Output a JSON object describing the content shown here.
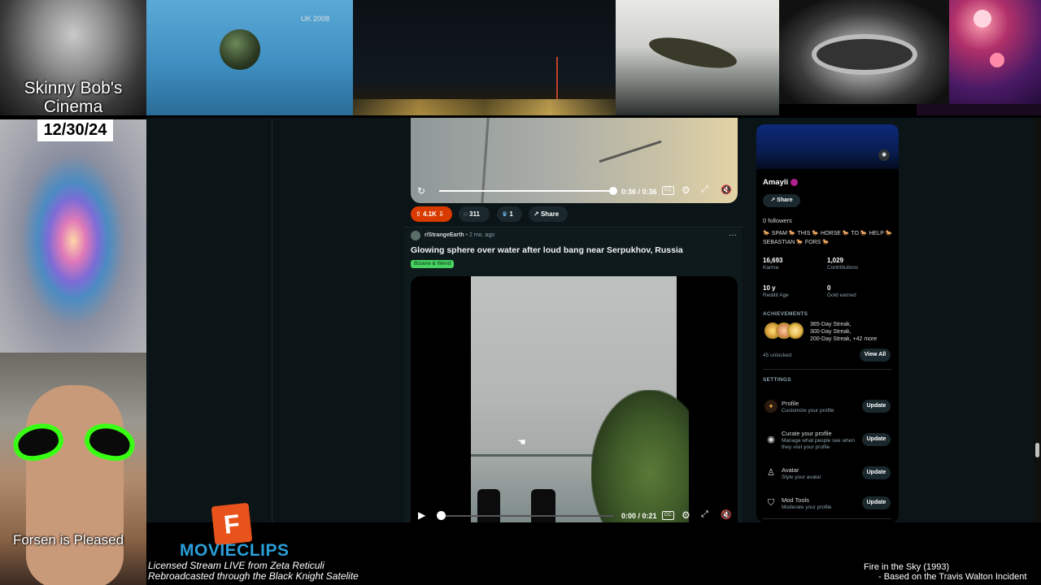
{
  "overlay": {
    "cinema_title": "Skinny Bob's Cinema",
    "date": "12/30/24",
    "thumb2_text": "UK 2008",
    "forsen_caption": "Forsen is Pleased",
    "movieclips_brand": "MOVIECLIPS",
    "licensed_line1": "Licensed Stream LIVE from Zeta Reticuli",
    "licensed_line2": "Rebroadcasted through the Black Knight Satelite",
    "movie_title": "Fire in the Sky (1993)",
    "movie_subtitle": "- Based on the Travis Walton Incident"
  },
  "post1": {
    "time": "0:36 / 0:36",
    "progress": 1.0,
    "vote_count": "4.1K",
    "comment_count": "311",
    "award_count": "1",
    "share_label": "Share"
  },
  "post2": {
    "subreddit": "r/StrangeEarth",
    "age": "2 mo. ago",
    "title": "Glowing sphere over water after loud bang near Serpukhov, Russia",
    "flair": "Bizarre & Weird",
    "time": "0:00 / 0:21",
    "progress": 0.0
  },
  "profile": {
    "username": "Amayli",
    "share_label": "Share",
    "followers": "0 followers",
    "bio": "🐎 SPAM 🐎 THIS 🐎 HORSE 🐎 TO 🐎 HELP 🐎 SEBASTIAN 🐎 FORS 🐎",
    "karma_value": "16,693",
    "karma_label": "Karma",
    "contrib_value": "1,029",
    "contrib_label": "Contributions",
    "age_value": "10 y",
    "age_label": "Reddit Age",
    "gold_value": "0",
    "gold_label": "Gold earned",
    "achievements_heading": "ACHIEVEMENTS",
    "achievements_line1": "365-Day Streak,",
    "achievements_line2": "300-Day Streak,",
    "achievements_line3": "200-Day Streak, +42 more",
    "unlocked": "45 unlocked",
    "view_all": "View All",
    "settings_heading": "SETTINGS",
    "settings": [
      {
        "title": "Profile",
        "desc": "Customize your profile",
        "button": "Update"
      },
      {
        "title": "Curate your profile",
        "desc": "Manage what people see when they visit your profile",
        "button": "Update"
      },
      {
        "title": "Avatar",
        "desc": "Style your avatar",
        "button": "Update"
      },
      {
        "title": "Mod Tools",
        "desc": "Moderate your profile",
        "button": "Update"
      }
    ]
  },
  "colors": {
    "reddit_bg": "#0b1416",
    "upvote_orange": "#d93a00",
    "flair_green": "#46d160",
    "movieclips_blue": "#2a9fd8",
    "movieclips_orange": "#e8521b",
    "alien_glasses": "#39ff14"
  }
}
